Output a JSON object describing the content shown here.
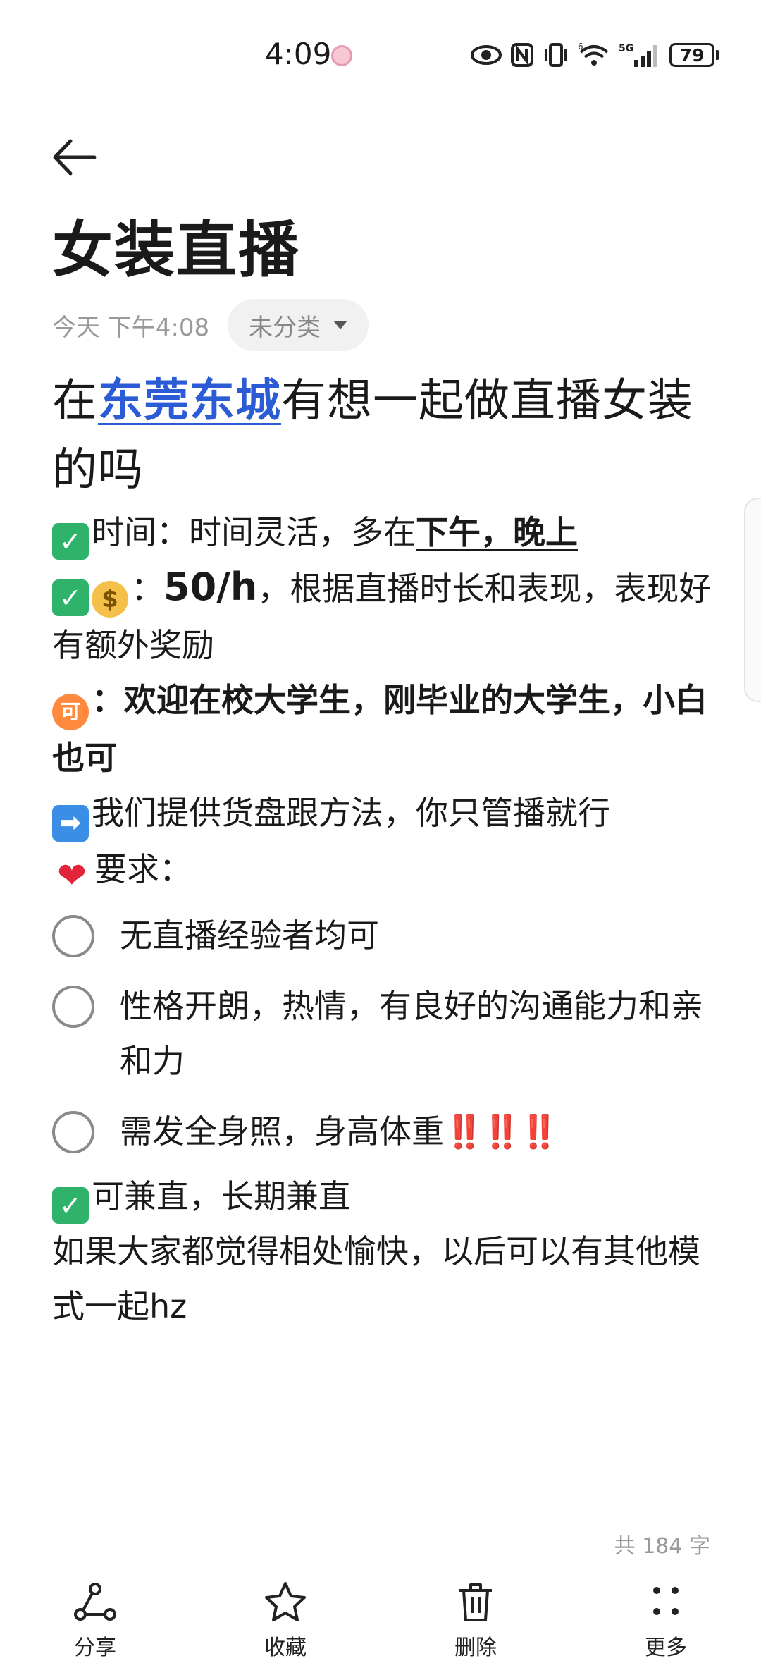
{
  "status_bar": {
    "time": "4:09",
    "network": "5G",
    "wifi_label": "6",
    "battery": "79"
  },
  "note": {
    "title": "女装直播",
    "timestamp": "今天 下午4:08",
    "category": "未分类",
    "headline_prefix": "在",
    "headline_link": "东莞东城",
    "headline_suffix": "有想一起做直播女装的吗",
    "time_label": "时间：时间灵活，多在",
    "time_emphasis": "下午，晚上",
    "pay_colon": "：",
    "pay_rate": "50/h",
    "pay_text": "，根据直播时长和表现，表现好有额外奖励",
    "who_text": "：欢迎在校大学生，刚毕业的大学生，小白也可",
    "provide_text": "我们提供货盘跟方法，你只管播就行",
    "req_label": "要求：",
    "todos": [
      "无直播经验者均可",
      "性格开朗，热情，有良好的沟通能力和亲和力",
      "需发全身照，身高体重"
    ],
    "todo_bangs": "‼️‼️‼️",
    "parttime_text": "可兼直，长期兼直",
    "closing_text": "如果大家都觉得相处愉快，以后可以有其他模式一起hz",
    "word_count": "共 184 字"
  },
  "bottom_bar": {
    "share": "分享",
    "favorite": "收藏",
    "delete": "删除",
    "more": "更多"
  },
  "icons": {
    "check": "✓",
    "money": "$",
    "ke": "可",
    "arrow": "➡",
    "heart": "❤"
  }
}
